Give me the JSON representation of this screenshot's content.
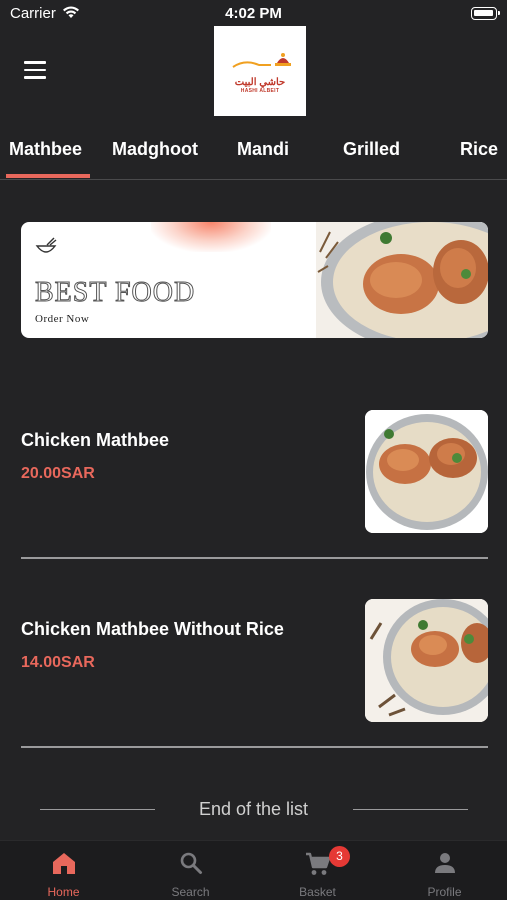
{
  "status_bar": {
    "carrier": "Carrier",
    "time": "4:02 PM"
  },
  "header": {
    "logo_arabic": "حاشي البيت",
    "logo_english": "HASHI ALBEIT"
  },
  "tabs": [
    {
      "label": "Mathbee",
      "active": true
    },
    {
      "label": "Madghoot",
      "active": false
    },
    {
      "label": "Mandi",
      "active": false
    },
    {
      "label": "Grilled",
      "active": false
    },
    {
      "label": "Rice",
      "active": false
    }
  ],
  "banner": {
    "title": "BEST FOOD",
    "subtitle": "Order Now"
  },
  "items": [
    {
      "name": "Chicken Mathbee",
      "price": "20.00SAR"
    },
    {
      "name": "Chicken Mathbee Without Rice",
      "price": "14.00SAR"
    }
  ],
  "end_of_list": "End of the list",
  "bottom_nav": {
    "items": [
      {
        "label": "Home",
        "icon": "home-icon",
        "active": true
      },
      {
        "label": "Search",
        "icon": "search-icon",
        "active": false
      },
      {
        "label": "Basket",
        "icon": "cart-icon",
        "active": false,
        "badge": "3"
      },
      {
        "label": "Profile",
        "icon": "person-icon",
        "active": false
      }
    ]
  },
  "colors": {
    "accent": "#e8685c",
    "background": "#232325",
    "nav_background": "#1c1c1e",
    "badge": "#e53935"
  }
}
